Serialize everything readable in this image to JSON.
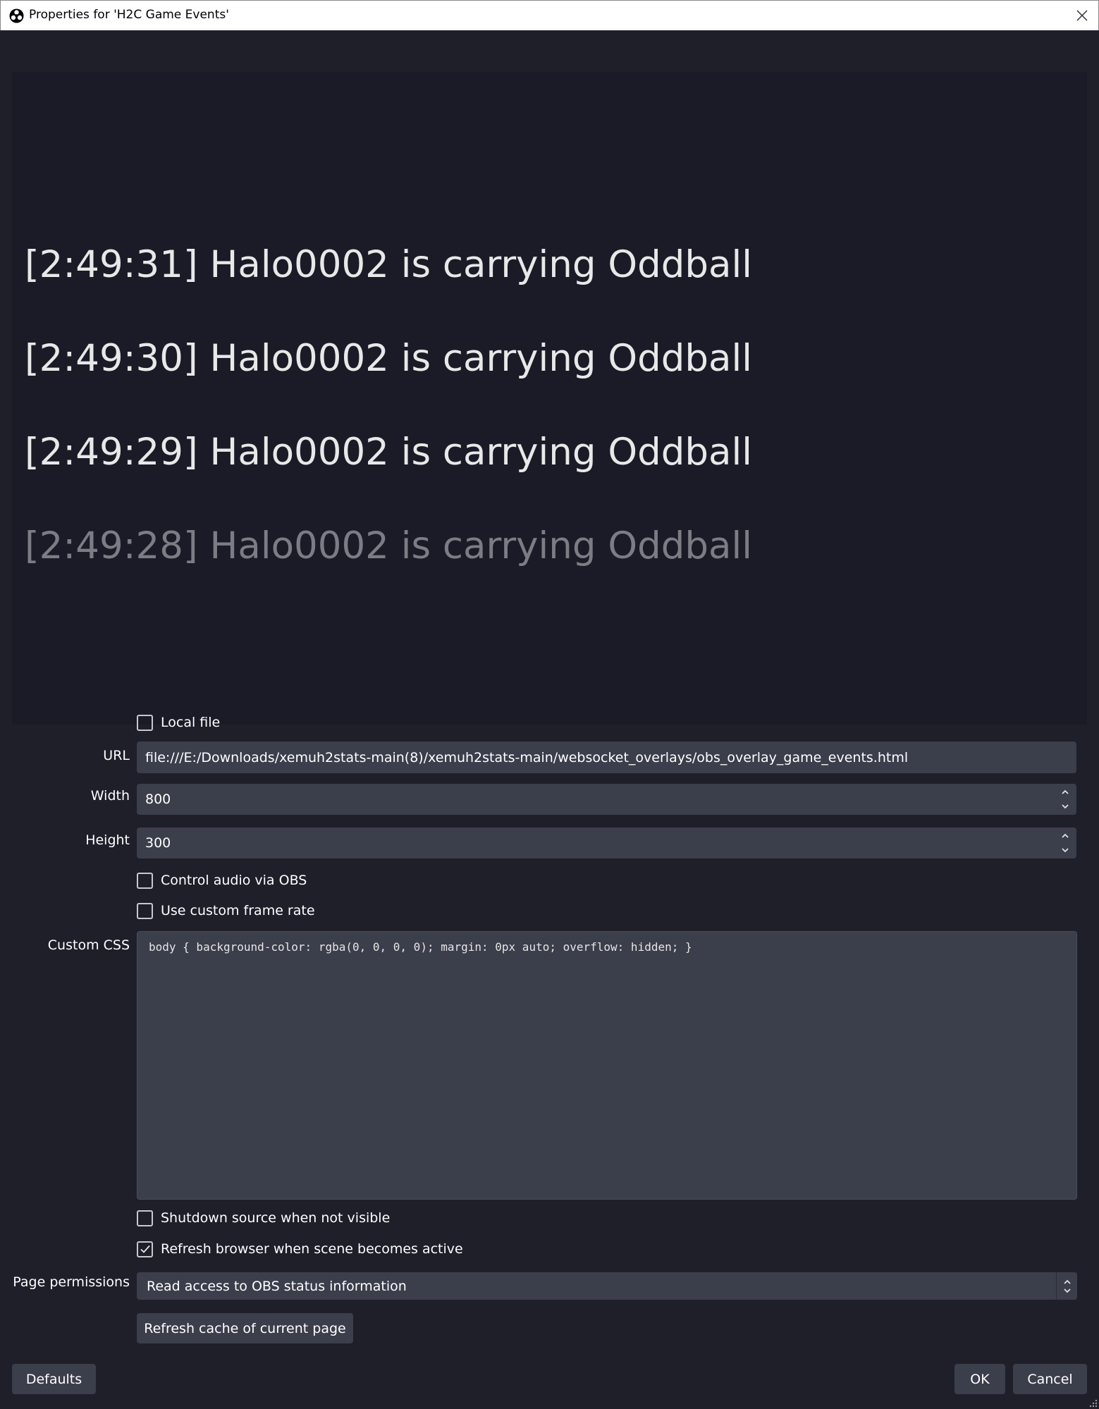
{
  "window": {
    "title": "Properties for 'H2C Game Events'"
  },
  "preview": {
    "events": [
      {
        "text": "[2:49:31] Halo0002 is carrying Oddball",
        "faded": false
      },
      {
        "text": "[2:49:30] Halo0002 is carrying Oddball",
        "faded": false
      },
      {
        "text": "[2:49:29] Halo0002 is carrying Oddball",
        "faded": false
      },
      {
        "text": "[2:49:28] Halo0002 is carrying Oddball",
        "faded": true
      }
    ]
  },
  "form": {
    "local_file": {
      "label": "Local file",
      "checked": false
    },
    "url": {
      "label": "URL",
      "value": "file:///E:/Downloads/xemuh2stats-main(8)/xemuh2stats-main/websocket_overlays/obs_overlay_game_events.html"
    },
    "width": {
      "label": "Width",
      "value": "800"
    },
    "height": {
      "label": "Height",
      "value": "300"
    },
    "control_audio": {
      "label": "Control audio via OBS",
      "checked": false
    },
    "custom_frame_rate": {
      "label": "Use custom frame rate",
      "checked": false
    },
    "custom_css": {
      "label": "Custom CSS",
      "value": "body { background-color: rgba(0, 0, 0, 0); margin: 0px auto; overflow: hidden; }"
    },
    "shutdown_source": {
      "label": "Shutdown source when not visible",
      "checked": false
    },
    "refresh_browser": {
      "label": "Refresh browser when scene becomes active",
      "checked": true
    },
    "page_permissions": {
      "label": "Page permissions",
      "value": "Read access to OBS status information"
    },
    "refresh_cache_button": "Refresh cache of current page"
  },
  "footer": {
    "defaults": "Defaults",
    "ok": "OK",
    "cancel": "Cancel"
  },
  "icons": {
    "app": "obs-logo-icon",
    "close": "close-icon",
    "check": "checkmark-icon",
    "spin": "spin-up-down-icon",
    "resize": "resize-grip-icon"
  }
}
